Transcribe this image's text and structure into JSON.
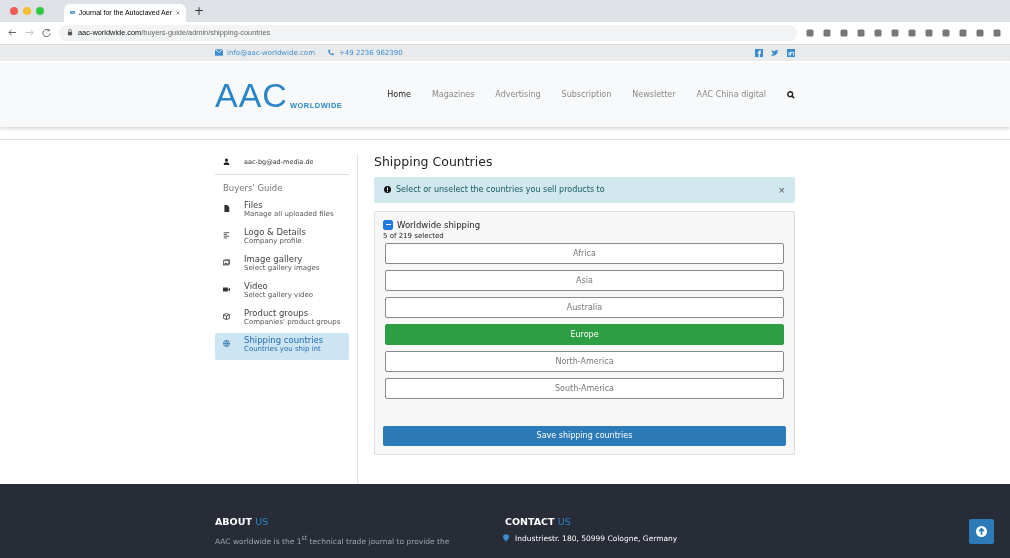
{
  "browser": {
    "tab_title": "Journal for the Autoclaved Aer",
    "new_tab": "+",
    "url_host": "aac-worldwide.com",
    "url_path": "/buyers-guide/admin/shipping-countries"
  },
  "topbar": {
    "email": "info@aac-worldwide.com",
    "phone": "+49 2236 962390"
  },
  "header": {
    "logo": "AAC",
    "logo_sub": "WORLDWIDE",
    "nav": [
      {
        "label": "Home",
        "selected": true
      },
      {
        "label": "Magazines",
        "selected": false
      },
      {
        "label": "Advertising",
        "selected": false
      },
      {
        "label": "Subscription",
        "selected": false
      },
      {
        "label": "Newsletter",
        "selected": false
      },
      {
        "label": "AAC China digital",
        "selected": false
      }
    ]
  },
  "sidebar": {
    "user": "aac-bg@ad-media.de",
    "section": "Buyers' Guide",
    "items": [
      {
        "kind": "file",
        "title": "Files",
        "subtitle": "Manage all uploaded files",
        "selected": false
      },
      {
        "kind": "lines",
        "title": "Logo & Details",
        "subtitle": "Company profile",
        "selected": false
      },
      {
        "kind": "images",
        "title": "Image gallery",
        "subtitle": "Select gallery images",
        "selected": false
      },
      {
        "kind": "video",
        "title": "Video",
        "subtitle": "Select gallery video",
        "selected": false
      },
      {
        "kind": "cube",
        "title": "Product groups",
        "subtitle": "Companies' product groups",
        "selected": false
      },
      {
        "kind": "globe",
        "title": "Shipping countries",
        "subtitle": "Countries you ship int",
        "selected": true
      }
    ]
  },
  "main": {
    "title": "Shipping Countries",
    "alert": "Select or unselect the countries you sell products to",
    "alert_close": "×",
    "worldwide": {
      "label": "Worldwide shipping",
      "indeterminate": true,
      "count": "5 of 219 selected"
    },
    "regions": [
      {
        "label": "Africa",
        "selected": false
      },
      {
        "label": "Asia",
        "selected": false
      },
      {
        "label": "Australia",
        "selected": false
      },
      {
        "label": "Europe",
        "selected": true
      },
      {
        "label": "North-America",
        "selected": false
      },
      {
        "label": "South-America",
        "selected": false
      }
    ],
    "save": "Save shipping countries"
  },
  "footer": {
    "about": {
      "title": "ABOUT",
      "accent": "US",
      "text": "AAC worldwide is the 1$^{st}$ technical trade journal to provide the"
    },
    "contact": {
      "title": "CONTACT",
      "accent": "US",
      "address": "Industriestr. 180, 50999 Cologne, Germany"
    }
  }
}
